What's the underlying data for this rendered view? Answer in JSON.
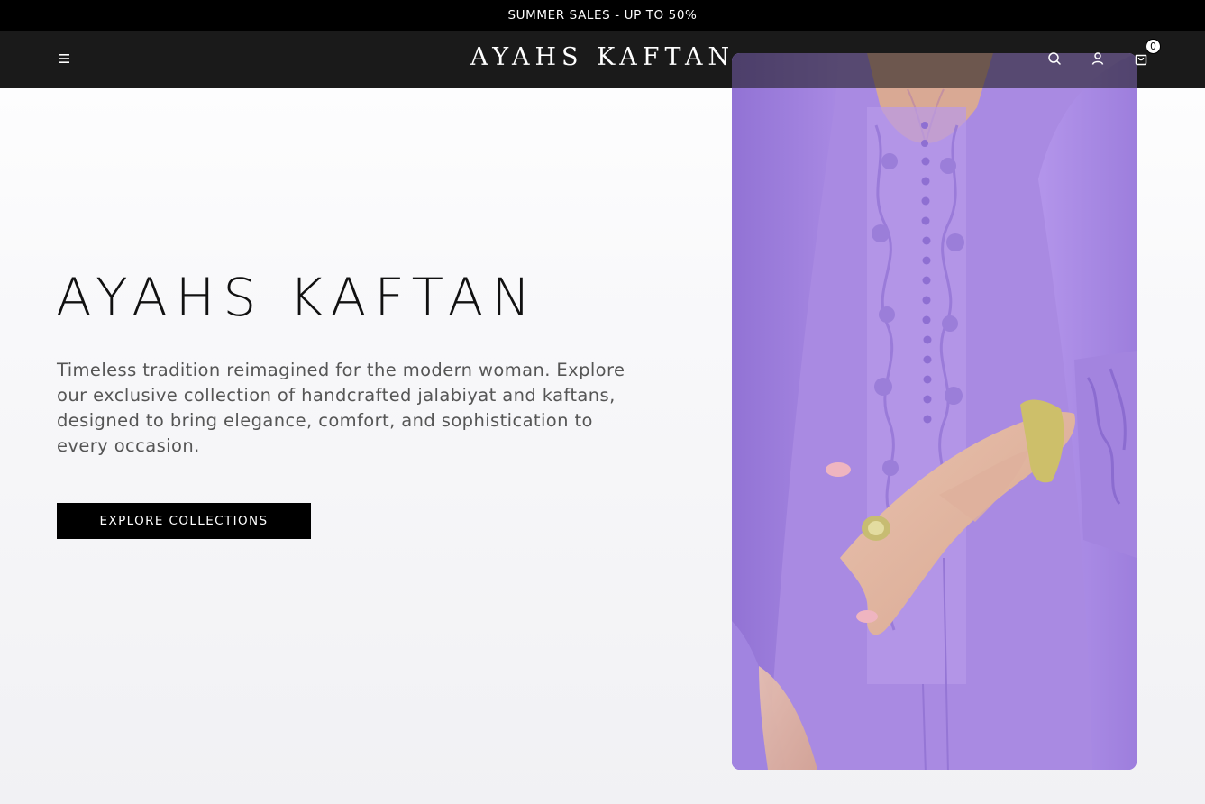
{
  "announcement": {
    "text": "SUMMER SALES - UP TO 50%"
  },
  "header": {
    "logo": "AYAHS KAFTAN",
    "menu_icon": "hamburger-menu-icon",
    "search_icon": "search-icon",
    "account_icon": "user-icon",
    "cart_icon": "shopping-bag-icon",
    "cart_count": "0"
  },
  "hero": {
    "title": "AYAHS KAFTAN",
    "description": "Timeless tradition reimagined for the modern woman. Explore our exclusive collection of handcrafted jalabiyat and kaftans, designed to bring elegance, comfort, and sophistication to every occasion.",
    "cta_label": "EXPLORE COLLECTIONS",
    "image_subject": "woman in lilac embroidered kaftan with gold bracelet and ring"
  },
  "colors": {
    "announcement_bg": "#000000",
    "header_bg": "#1a1a1a",
    "accent_lilac": "#a98ae2",
    "button_bg": "#000000",
    "page_bg": "#f6f6f8"
  }
}
